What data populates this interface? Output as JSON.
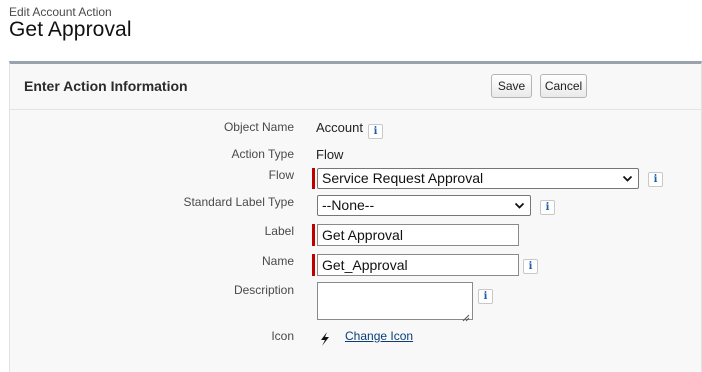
{
  "header": {
    "subtitle": "Edit Account Action",
    "title": "Get Approval"
  },
  "panel": {
    "title": "Enter Action Information",
    "save_label": "Save",
    "cancel_label": "Cancel"
  },
  "form": {
    "object_name": {
      "label": "Object Name",
      "value": "Account"
    },
    "action_type": {
      "label": "Action Type",
      "value": "Flow"
    },
    "flow": {
      "label": "Flow",
      "selected": "Service Request Approval"
    },
    "standard_label_type": {
      "label": "Standard Label Type",
      "selected": "--None--"
    },
    "label": {
      "label": "Label",
      "value": "Get Approval"
    },
    "name": {
      "label": "Name",
      "value": "Get_Approval"
    },
    "description": {
      "label": "Description",
      "value": ""
    },
    "icon": {
      "label": "Icon",
      "link": "Change Icon",
      "icon_name": "lightning-bolt-icon"
    }
  },
  "colors": {
    "required": "#c00000",
    "info_icon": "#1f5fa8",
    "link": "#0b3d78",
    "panel_border": "#9aa3ad"
  }
}
